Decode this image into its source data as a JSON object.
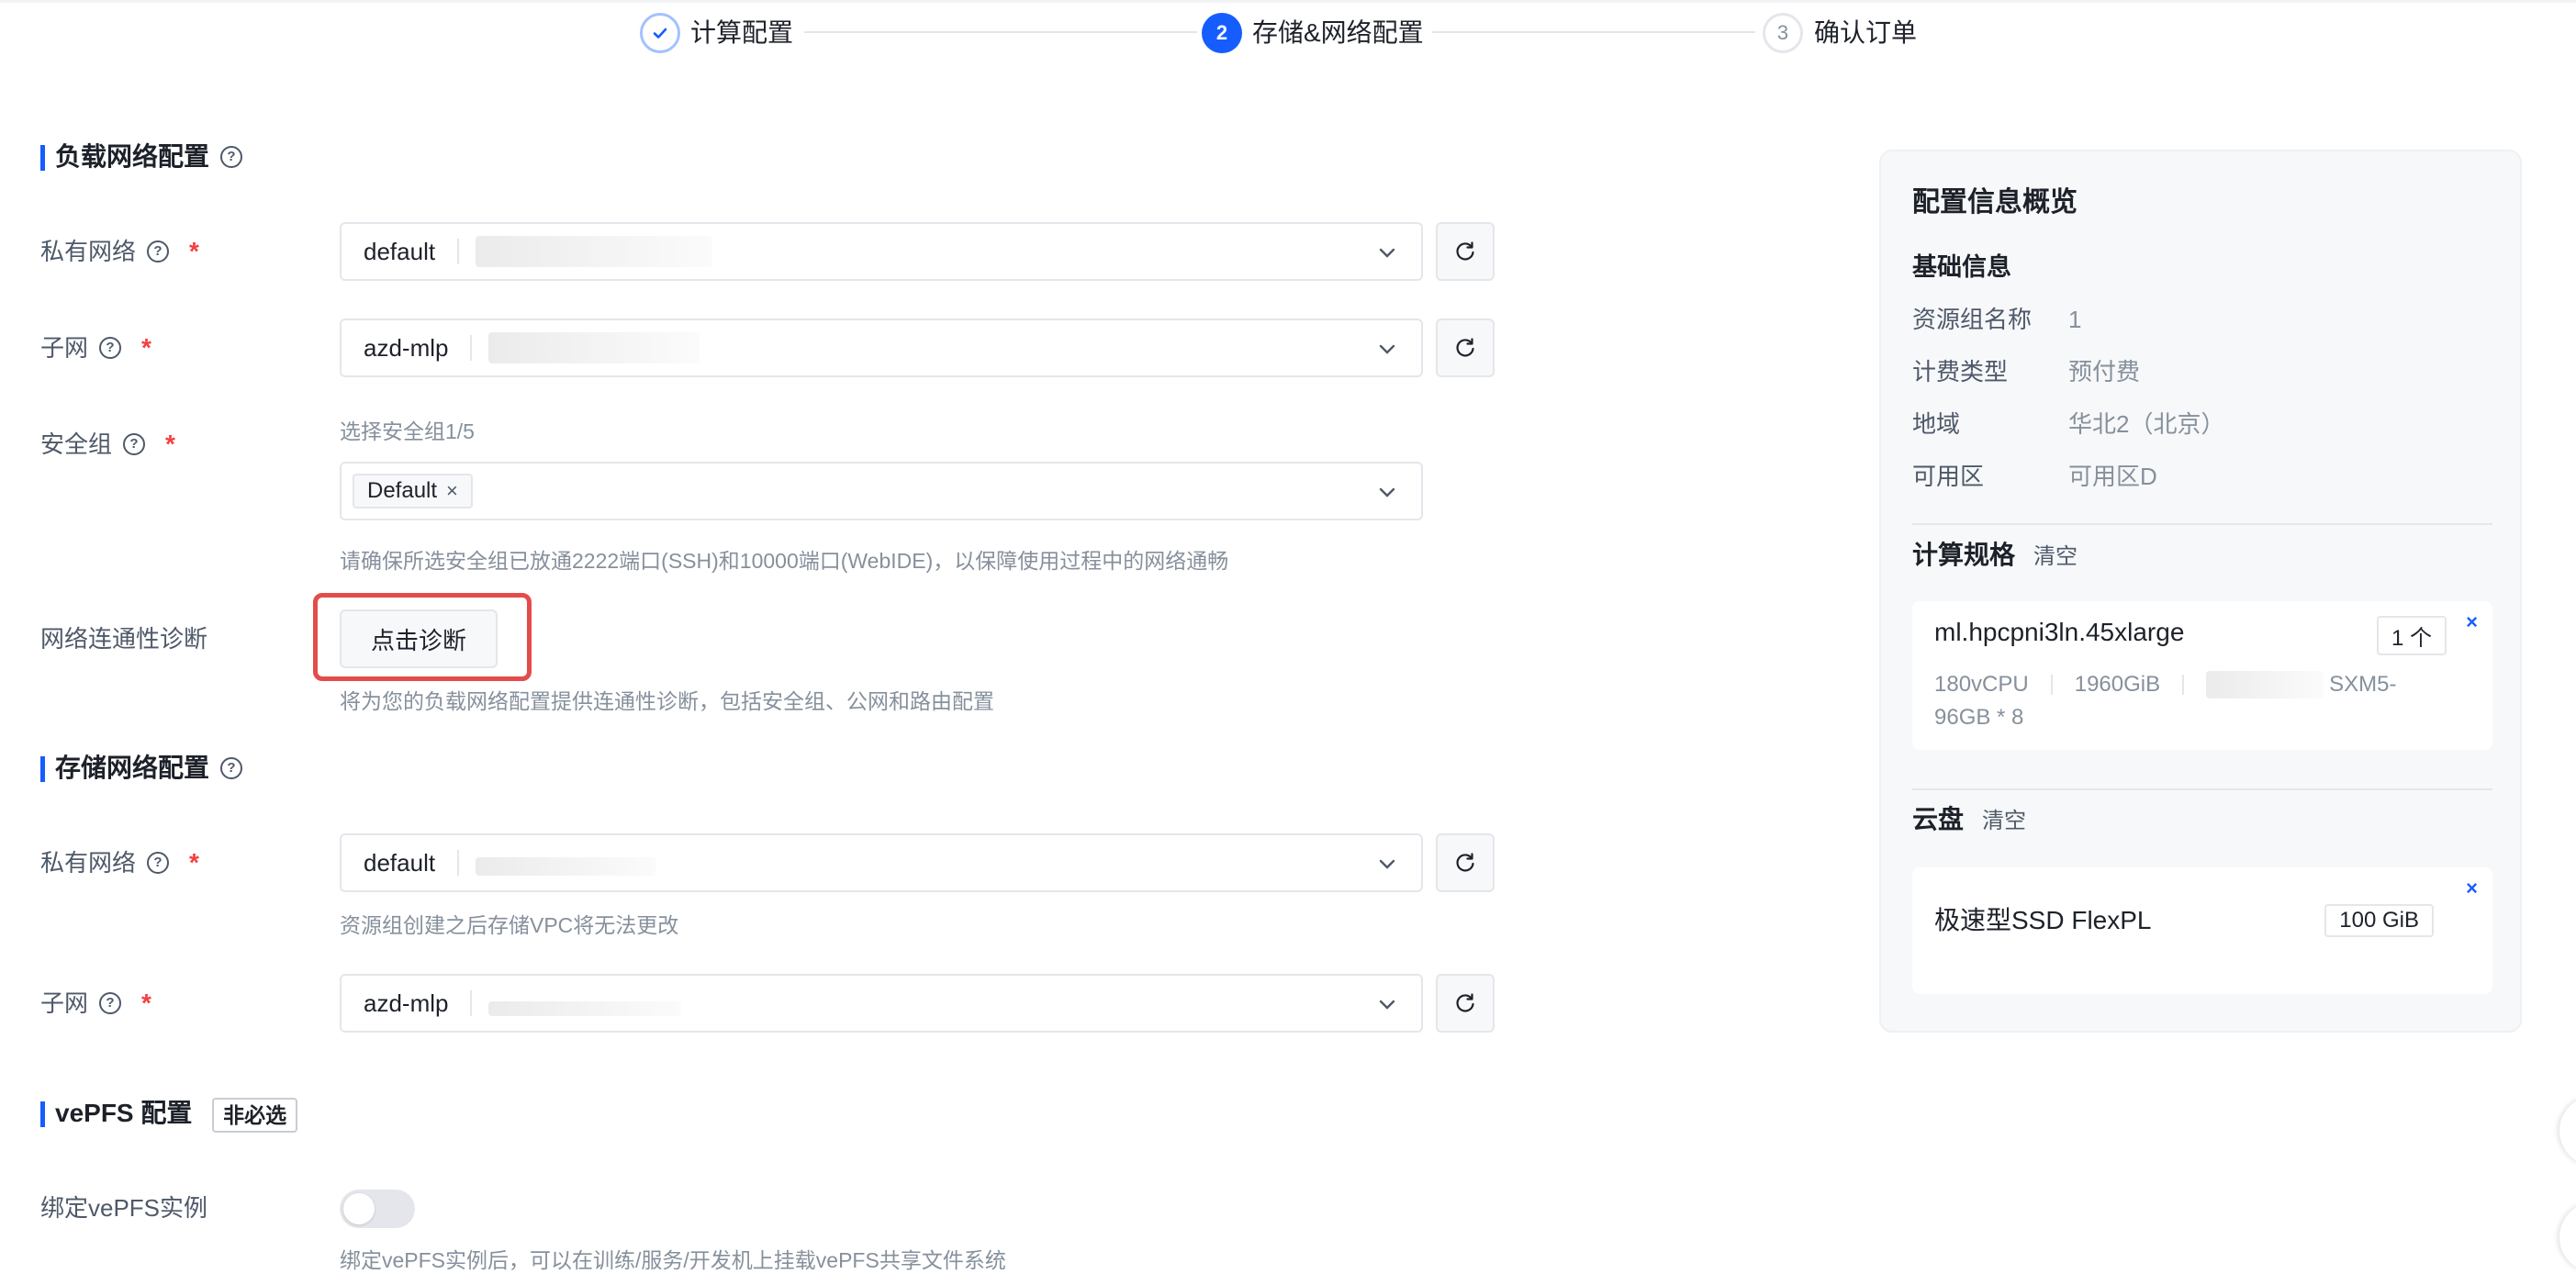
{
  "steps": [
    {
      "index": "",
      "label": "计算配置",
      "state": "done"
    },
    {
      "index": "2",
      "label": "存储&网络配置",
      "state": "active"
    },
    {
      "index": "3",
      "label": "确认订单",
      "state": "todo"
    }
  ],
  "load_network": {
    "title": "负载网络配置",
    "vpc": {
      "label": "私有网络",
      "value": "default"
    },
    "subnet": {
      "label": "子网",
      "value": "azd-mlp"
    },
    "security_group": {
      "label": "安全组",
      "counter": "选择安全组1/5",
      "tag": "Default",
      "hint": "请确保所选安全组已放通2222端口(SSH)和10000端口(WebIDE)，以保障使用过程中的网络通畅"
    },
    "diagnosis": {
      "label": "网络连通性诊断",
      "button": "点击诊断",
      "hint": "将为您的负载网络配置提供连通性诊断，包括安全组、公网和路由配置"
    }
  },
  "storage_network": {
    "title": "存储网络配置",
    "vpc": {
      "label": "私有网络",
      "value": "default",
      "hint": "资源组创建之后存储VPC将无法更改"
    },
    "subnet": {
      "label": "子网",
      "value": "azd-mlp"
    }
  },
  "vepfs": {
    "title": "vePFS 配置",
    "optional_badge": "非必选",
    "bind_label": "绑定vePFS实例",
    "bind_enabled": false,
    "hint": "绑定vePFS实例后，可以在训练/服务/开发机上挂载vePFS共享文件系统"
  },
  "summary": {
    "title": "配置信息概览",
    "basic_title": "基础信息",
    "basic": [
      {
        "key": "资源组名称",
        "value": "1"
      },
      {
        "key": "计费类型",
        "value": "预付费"
      },
      {
        "key": "地域",
        "value": "华北2（北京）"
      },
      {
        "key": "可用区",
        "value": "可用区D"
      }
    ],
    "compute": {
      "title": "计算规格",
      "clear": "清空",
      "spec": "ml.hpcpni3ln.45xlarge",
      "count": "1 个",
      "cpu": "180vCPU",
      "mem": "1960GiB",
      "gpu_suffix": "SXM5-",
      "gpu_line2": "96GB * 8"
    },
    "disk": {
      "title": "云盘",
      "clear": "清空",
      "type": "极速型SSD FlexPL",
      "size": "100 GiB"
    },
    "close_glyph": "×"
  },
  "icons": {
    "check": "check-icon",
    "help": "help-circle-icon",
    "chevron": "chevron-down-icon",
    "refresh": "refresh-icon",
    "close": "close-icon"
  },
  "colors": {
    "primary": "#165dff",
    "required": "#f53f3f",
    "highlight": "#e54b4b"
  }
}
